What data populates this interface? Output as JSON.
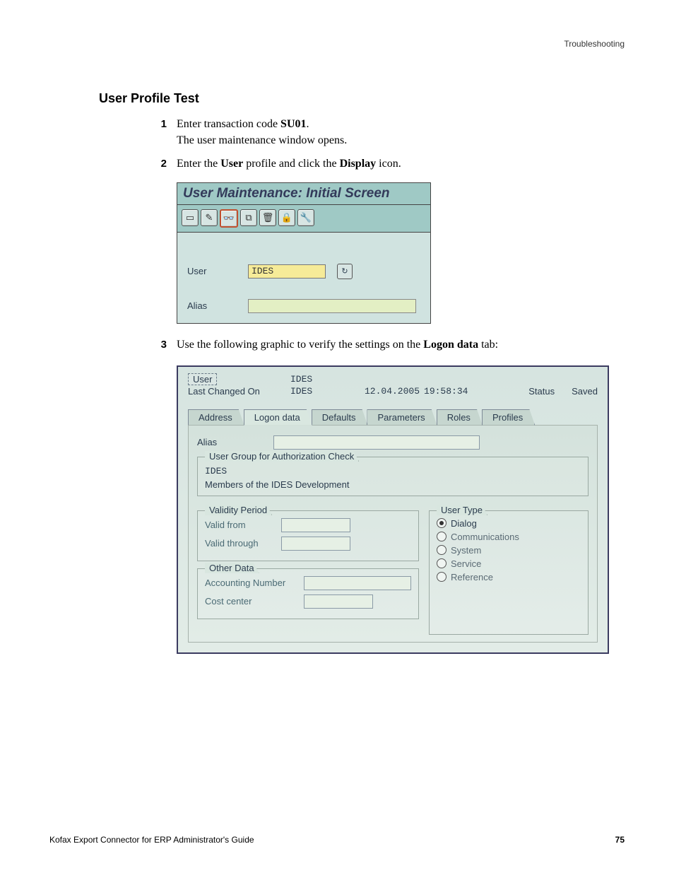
{
  "header": {
    "right": "Troubleshooting"
  },
  "section_heading": "User Profile Test",
  "steps": {
    "s1": {
      "num": "1",
      "t1": "Enter transaction code ",
      "t1b": "SU01",
      "t1end": ".",
      "t2": "The user maintenance window opens."
    },
    "s2": {
      "num": "2",
      "a": "Enter the ",
      "b": "User",
      "c": " profile and click the ",
      "d": "Display",
      "e": " icon."
    },
    "s3": {
      "num": "3",
      "a": "Use the following graphic to verify the settings on the ",
      "b": "Logon data",
      "c": " tab:"
    }
  },
  "sap1": {
    "title": "User Maintenance: Initial Screen",
    "icons": {
      "new": "▭",
      "edit": "✎",
      "display": "👓",
      "copy": "⧉",
      "delete": "🗑",
      "lock": "🔒",
      "wrench": "🔧"
    },
    "user_label": "User",
    "user_value": "IDES",
    "cycle_icon": "↻",
    "alias_label": "Alias"
  },
  "sap2": {
    "user_label": "User",
    "user_value": "IDES",
    "lastchg_label": "Last Changed On",
    "lastchg_by": "IDES",
    "lastchg_date": "12.04.2005",
    "lastchg_time": "19:58:34",
    "status_label": "Status",
    "status_value": "Saved",
    "tabs": [
      "Address",
      "Logon data",
      "Defaults",
      "Parameters",
      "Roles",
      "Profiles"
    ],
    "alias_label": "Alias",
    "grp_legend": "User Group for Authorization Check",
    "grp_value": "IDES",
    "grp_desc": "Members of the IDES Development",
    "validity_legend": "Validity Period",
    "valid_from": "Valid from",
    "valid_through": "Valid through",
    "usertype_legend": "User Type",
    "radios": [
      "Dialog",
      "Communications",
      "System",
      "Service",
      "Reference"
    ],
    "otherdata_legend": "Other Data",
    "acct_num": "Accounting Number",
    "cost_center": "Cost center"
  },
  "footer": {
    "left": "Kofax Export Connector for ERP Administrator's Guide",
    "right": "75"
  }
}
